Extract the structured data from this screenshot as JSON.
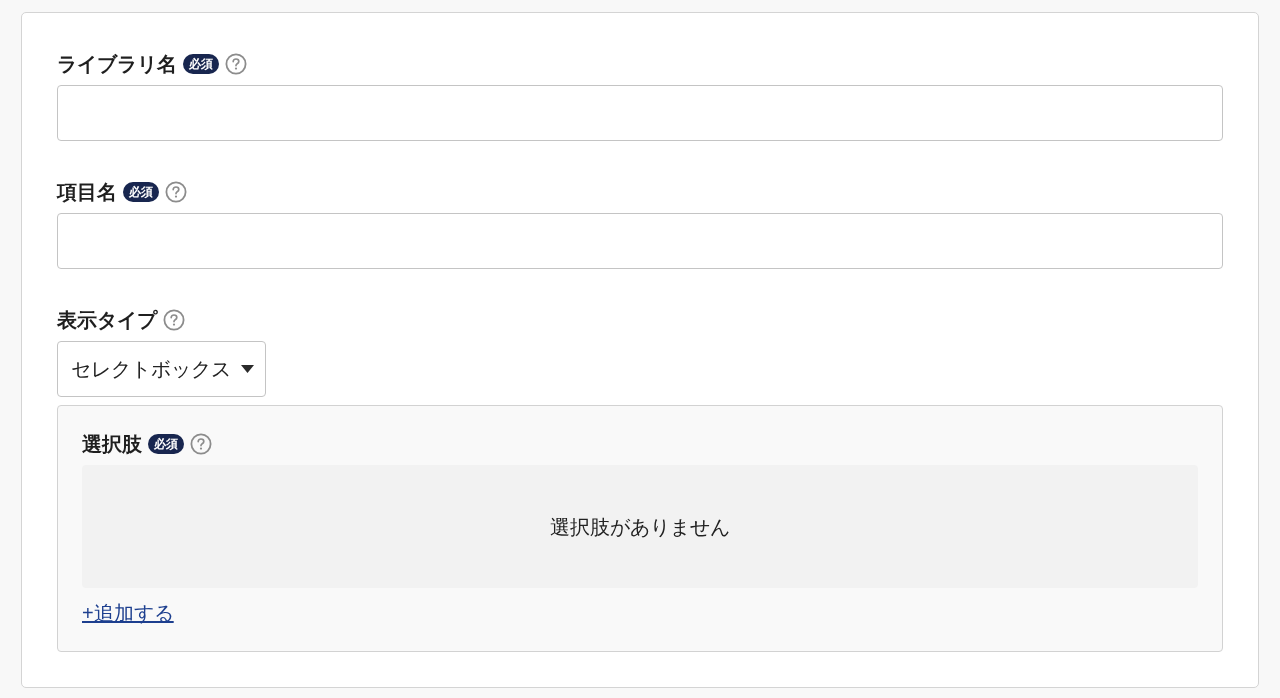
{
  "form": {
    "fields": [
      {
        "kind": "text",
        "label": "ライブラリ名",
        "badge": "必須"
      },
      {
        "kind": "text",
        "label": "項目名",
        "badge": "必須"
      },
      {
        "kind": "select",
        "label": "表示タイプ",
        "value": "セレクトボックス",
        "options_panel": {
          "label": "選択肢",
          "badge": "必須",
          "empty_message": "選択肢がありません",
          "add_link": "+追加する"
        }
      }
    ]
  }
}
